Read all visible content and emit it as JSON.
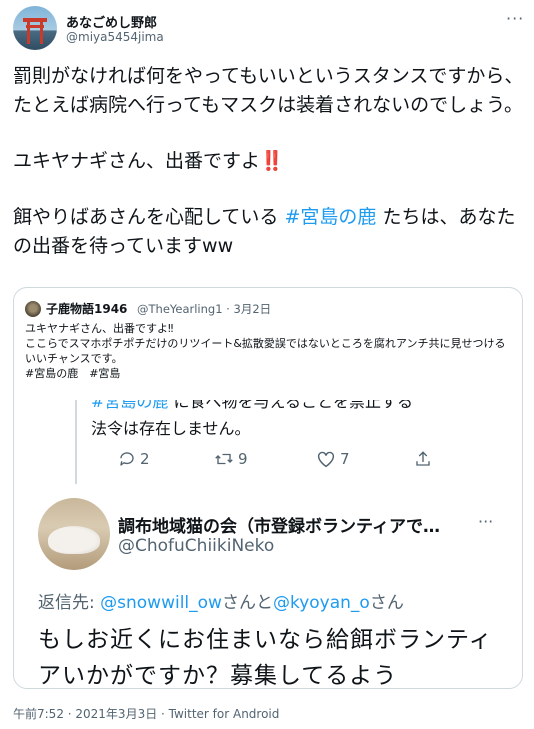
{
  "author": {
    "name": "あなごめし野郎",
    "handle": "@miya5454jima"
  },
  "more_label": "···",
  "tweet": {
    "p1": "罰則がなければ何をやってもいいというスタンスですから、たとえば病院へ行ってもマスクは装着されないのでしょう。",
    "p2_text": "ユキヤナギさん、出番ですよ",
    "p2_emoji": "‼️",
    "p3_before": "餌やりばあさんを心配している ",
    "p3_hashtag": "#宮島の鹿",
    "p3_after": " たちは、あなたの出番を待っていますww"
  },
  "quote": {
    "name": "子鹿物語1946",
    "handle_date": "@TheYearling1 · 3月2日",
    "lines": [
      "ユキヤナギさん、出番ですよ‼",
      "ここらでスマホポチポチだけのリツイート&拡散愛誤ではないところを腐れアンチ共に見せつけるいいチャンスです。",
      "#宮島の鹿　#宮島"
    ],
    "screenshot": {
      "cut_hashtag": "#宮島の鹿",
      "cut_rest": " に食べ物を与えることを禁止する",
      "law_line": "法令は存在しません。",
      "counts": {
        "reply": "2",
        "retweet": "9",
        "like": "7"
      },
      "reply_author_name": "調布地域猫の会（市登録ボランティアで…",
      "reply_author_handle": "@ChofuChiikiNeko",
      "reply_to_label": "返信先: ",
      "reply_to_user1": "@snowwill_ow",
      "reply_to_mid": "さんと",
      "reply_to_user2": "@kyoyan_o",
      "reply_to_end": "さん",
      "reply_text": "もしお近くにお住まいなら給餌ボランティアいかがですか？募集してるよう"
    }
  },
  "footer": "午前7:52 · 2021年3月3日 · Twitter for Android",
  "icons": [
    "reply-icon",
    "retweet-icon",
    "like-icon",
    "share-icon",
    "more-icon"
  ]
}
